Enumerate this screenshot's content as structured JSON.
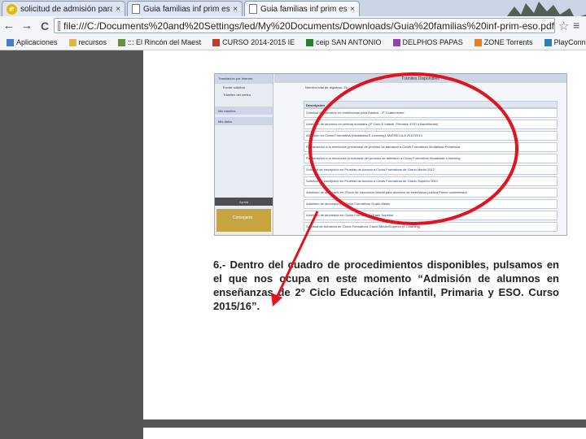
{
  "tabs": [
    {
      "title": "solicitud de admisión para En",
      "active": false,
      "favicon": "ie-icon"
    },
    {
      "title": "Guia familias inf prim eso.pdf",
      "active": false,
      "favicon": "document-icon"
    },
    {
      "title": "Guia familias inf prim eso.pdf",
      "active": true,
      "favicon": "document-icon"
    }
  ],
  "close_glyph": "×",
  "nav": {
    "back": "←",
    "forward": "→",
    "reload": "C"
  },
  "address": "file:///C:/Documents%20and%20Settings/led/My%20Documents/Downloads/Guia%20familias%20inf-prim-eso.pdf",
  "star_glyph": "☆",
  "menu_glyph": "≡",
  "bookmarks": [
    {
      "label": "Aplicaciones",
      "icon": "apps-icon",
      "color": "#4a7cc7"
    },
    {
      "label": "recursos",
      "icon": "folder-icon",
      "color": "#e0b84a"
    },
    {
      "label": "::: El Rincón del Maest",
      "icon": "page-icon",
      "color": "#6b8e3a"
    },
    {
      "label": "CURSO 2014-2015 IE",
      "icon": "page-icon",
      "color": "#c0392b"
    },
    {
      "label": "ceip SAN ANTONIO",
      "icon": "page-icon",
      "color": "#2e7d32"
    },
    {
      "label": "DELPHOS PAPAS",
      "icon": "page-icon",
      "color": "#8e44ad"
    },
    {
      "label": "ZONE Torrents",
      "icon": "page-icon",
      "color": "#e67e22"
    },
    {
      "label": "PlayConnection.sync",
      "icon": "page-icon",
      "color": "#2980b9"
    }
  ],
  "screenshot": {
    "left_panel": {
      "header": "Tramitación por Internet",
      "items": [
        "Enviar solicitud",
        "Trámites del centro"
      ],
      "sections": [
        "Mis trámites",
        "Mis datos"
      ],
      "dark_bar": "Ayuda",
      "gold_box": "Consejería"
    },
    "title": "Trámites Disponibles",
    "count_label": "Número total de registros: 15",
    "column_header": "Descripción",
    "rows": [
      "Solicitud de admisión en enseñanzas para Adultos - 2º Cuatrimestre",
      "Admisión de alumnos en centros docentes (2º Ciclo E.Infantil, Primaria, ESO y Bachillerato)",
      "Admisión en Ciclos Formativos (Modalidad E-Learning). MATRÍCULA 2012/2013",
      "Reclamación a la resolución provisional de proceso de admisión a Ciclos Formativos Modalidad Presencial",
      "Reclamación a la resolución provisional del proceso de admisión a Ciclos Formativos Modalidad e-learning",
      "Solicitud de inscripción en Pruebas de Acceso a Ciclos Formativos de Grado Medio 2012",
      "Solicitud de inscripción en Pruebas de Acceso a Ciclos Formativos de Grado Superior 2012",
      "Admisión de alumnado en 2ºciclo de educación infantil para alumnos de enseñanza pública Primer cuatrimestre",
      "Admisión de alumnado en Ciclos Formativos Grado Medio",
      "Admisión de alumnado en Ciclos Formativos Grado Superior",
      "Solicitud de Admisión de Ciclos Formativos Grado Medio/Superior (E-Learning)"
    ]
  },
  "paragraph": "6.- Dentro del cuadro de procedimientos disponibles, pulsamos en el que nos ocupa en este momento “Admisión de alumnos en enseñanzas de 2º Ciclo Educación Infantil, Primaria y ESO. Curso 2015/16”.",
  "colors": {
    "annotation": "#e0141e",
    "gold": "#c6a540",
    "link": "#22387a"
  }
}
